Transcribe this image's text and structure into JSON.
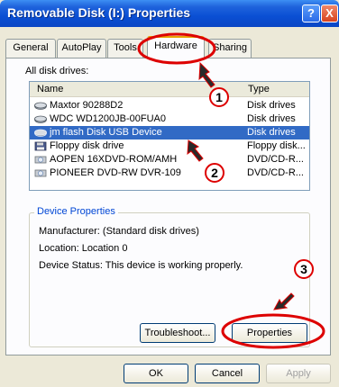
{
  "window": {
    "title": "Removable Disk (I:) Properties"
  },
  "title_buttons": {
    "help": "?",
    "close": "X"
  },
  "tabs": [
    {
      "label": "General"
    },
    {
      "label": "AutoPlay"
    },
    {
      "label": "Tools"
    },
    {
      "label": "Hardware"
    },
    {
      "label": "Sharing"
    }
  ],
  "all_drives_label": "All disk drives:",
  "list": {
    "headers": {
      "name": "Name",
      "type": "Type"
    },
    "rows": [
      {
        "name": "Maxtor 90288D2",
        "type": "Disk drives",
        "icon": "hard-disk-icon"
      },
      {
        "name": "WDC WD1200JB-00FUA0",
        "type": "Disk drives",
        "icon": "hard-disk-icon"
      },
      {
        "name": "jm flash Disk USB Device",
        "type": "Disk drives",
        "icon": "hard-disk-icon"
      },
      {
        "name": "Floppy disk drive",
        "type": "Floppy disk...",
        "icon": "floppy-drive-icon"
      },
      {
        "name": "AOPEN 16XDVD-ROM/AMH",
        "type": "DVD/CD-R...",
        "icon": "cd-drive-icon"
      },
      {
        "name": "PIONEER DVD-RW  DVR-109",
        "type": "DVD/CD-R...",
        "icon": "cd-drive-icon"
      }
    ]
  },
  "device_properties": {
    "legend": "Device Properties",
    "manufacturer": "Manufacturer: (Standard disk drives)",
    "location": "Location: Location 0",
    "status": "Device Status: This device is working properly."
  },
  "buttons": {
    "troubleshoot": "Troubleshoot...",
    "properties": "Properties",
    "ok": "OK",
    "cancel": "Cancel",
    "apply": "Apply"
  },
  "annotations": {
    "step1": "1",
    "step2": "2",
    "step3": "3"
  },
  "colors": {
    "highlight_circle": "#dd0000",
    "selection": "#316ac5",
    "titlebar": "#0a4fd4"
  }
}
